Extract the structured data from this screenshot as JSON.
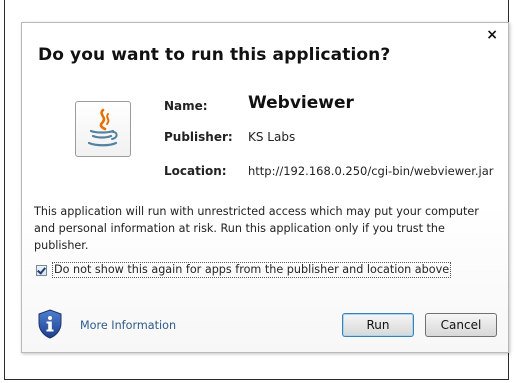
{
  "dialog": {
    "title": "Do you want to run this application?",
    "close_glyph": "×",
    "icon": "java-icon",
    "fields": {
      "name_label": "Name:",
      "name_value": "Webviewer",
      "publisher_label": "Publisher:",
      "publisher_value": "KS Labs",
      "location_label": "Location:",
      "location_value": "http://192.168.0.250/cgi-bin/webviewer.jar"
    },
    "warning": "This application will run with unrestricted access which may put your computer and personal information at risk. Run this application only if you trust the publisher.",
    "checkbox": {
      "label": "Do not show this again for apps from the publisher and location above",
      "checked": true
    },
    "more_info": {
      "icon": "shield-info-icon",
      "label": "More Information"
    },
    "buttons": {
      "run": "Run",
      "cancel": "Cancel"
    }
  }
}
